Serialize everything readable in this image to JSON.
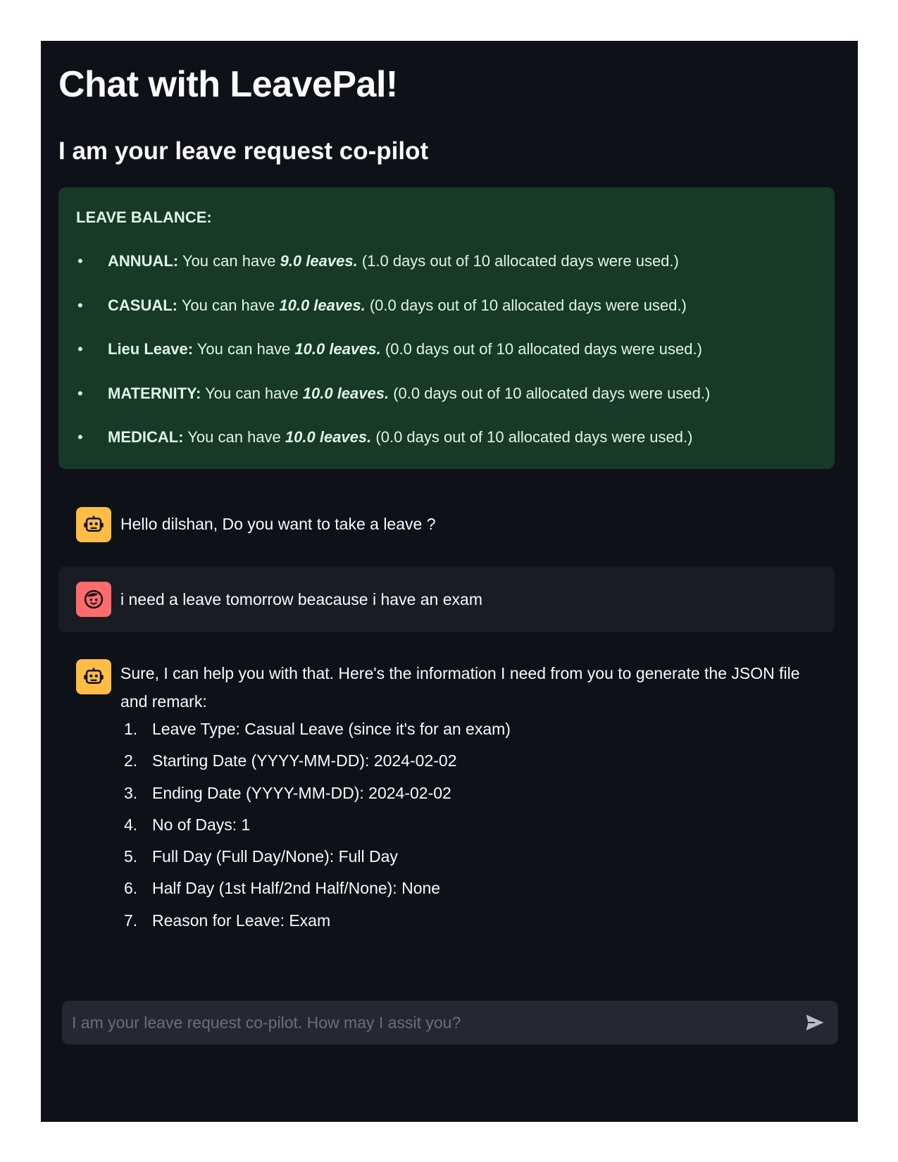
{
  "header": {
    "title": "Chat with LeavePal!",
    "subtitle": "I am your leave request co-pilot"
  },
  "leave_balance": {
    "heading": "LEAVE BALANCE:",
    "items": [
      {
        "type": "ANNUAL:",
        "prefix": "You can have",
        "count": "9.0 leaves.",
        "usage": "(1.0 days out of 10 allocated days were used.)"
      },
      {
        "type": "CASUAL:",
        "prefix": "You can have",
        "count": "10.0 leaves.",
        "usage": "(0.0 days out of 10 allocated days were used.)"
      },
      {
        "type": "Lieu Leave:",
        "prefix": "You can have",
        "count": "10.0 leaves.",
        "usage": "(0.0 days out of 10 allocated days were used.)"
      },
      {
        "type": "MATERNITY:",
        "prefix": "You can have",
        "count": "10.0 leaves.",
        "usage": "(0.0 days out of 10 allocated days were used.)"
      },
      {
        "type": "MEDICAL:",
        "prefix": "You can have",
        "count": "10.0 leaves.",
        "usage": "(0.0 days out of 10 allocated days were used.)"
      }
    ]
  },
  "messages": [
    {
      "role": "assistant",
      "avatar_icon": "robot-icon",
      "text": "Hello dilshan, Do you want to take a leave ?"
    },
    {
      "role": "user",
      "avatar_icon": "user-face-icon",
      "text": "i need a leave tomorrow beacause i have an exam"
    },
    {
      "role": "assistant",
      "avatar_icon": "robot-icon",
      "text": "Sure, I can help you with that. Here's the information I need from you to generate the JSON file and remark:",
      "steps": [
        {
          "num": "1.",
          "text": "Leave Type: Casual Leave (since it's for an exam)"
        },
        {
          "num": "2.",
          "text": "Starting Date (YYYY-MM-DD): 2024-02-02"
        },
        {
          "num": "3.",
          "text": "Ending Date (YYYY-MM-DD): 2024-02-02"
        },
        {
          "num": "4.",
          "text": "No of Days: 1"
        },
        {
          "num": "5.",
          "text": "Full Day (Full Day/None): Full Day"
        },
        {
          "num": "6.",
          "text": "Half Day (1st Half/2nd Half/None): None"
        },
        {
          "num": "7.",
          "text": "Reason for Leave: Exam"
        }
      ]
    }
  ],
  "chat_input": {
    "value": "",
    "placeholder": "I am your leave request co-pilot. How may I assit you?",
    "send_icon": "send-icon"
  },
  "colors": {
    "app_background": "#0e1117",
    "balance_background": "#173928",
    "user_message_background": "#1a1c24",
    "bot_avatar": "#ffbd45",
    "user_avatar": "#ff6b6b",
    "input_background": "#262730"
  }
}
